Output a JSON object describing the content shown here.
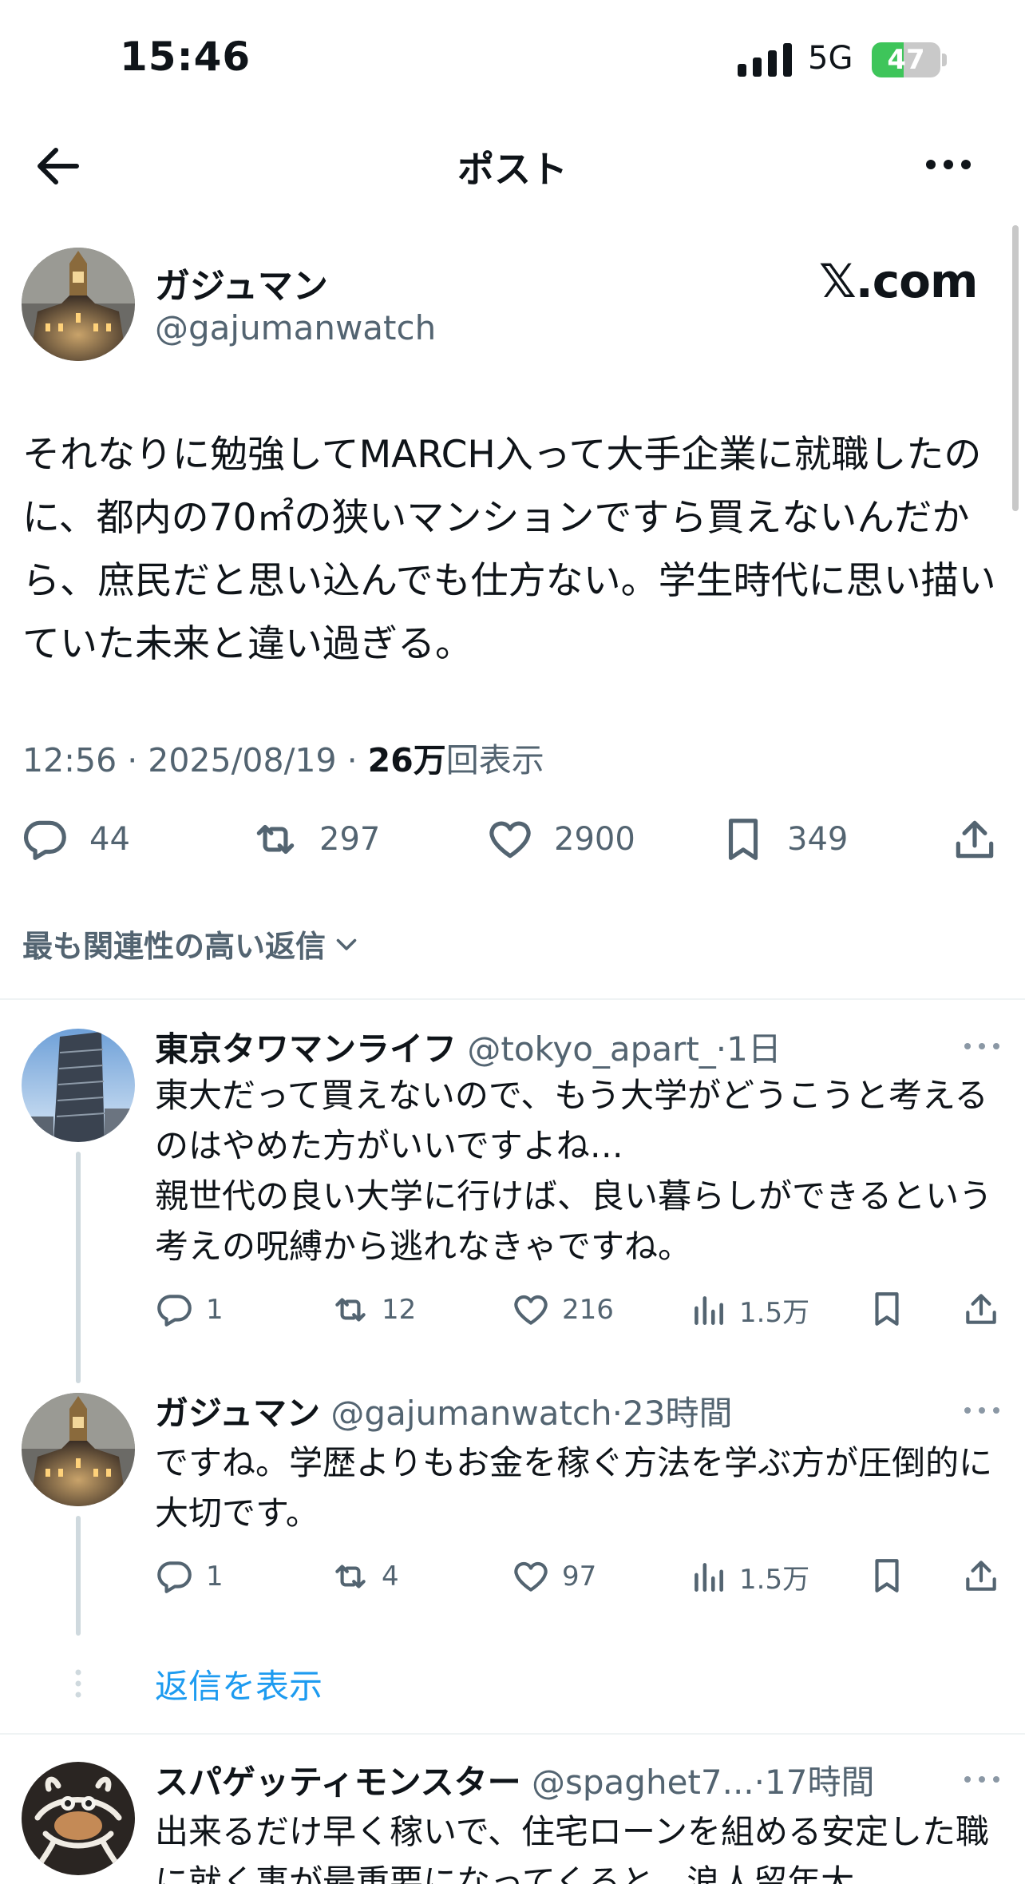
{
  "status_bar": {
    "time": "15:46",
    "network": "5G",
    "battery_percent": 47,
    "battery_label": "47"
  },
  "header": {
    "title": "ポスト",
    "back_icon": "arrow-left-icon",
    "more_icon": "ellipsis-icon"
  },
  "post": {
    "author_name": "ガジュマン",
    "author_handle": "@gajumanwatch",
    "watermark": "𝕏.com",
    "text": "それなりに勉強してMARCH入って大手企業に就職したのに、都内の70㎡の狭いマンションですら買えないんだから、庶民だと思い込んでも仕方ない。学生時代に思い描いていた未来と違い過ぎる。",
    "time": "12:56 · 2025/08/19 · ",
    "views_count": "26万",
    "views_label": "回表示",
    "replies": "44",
    "reposts": "297",
    "likes": "2900",
    "bookmarks": "349"
  },
  "sort": {
    "label": "最も関連性の高い返信"
  },
  "replies": [
    {
      "name": "東京タワマンライフ",
      "handle": "@tokyo_apart_",
      "time": "·1日",
      "text": "東大だって買えないので、もう大学がどうこうと考えるのはやめた方がいいですよね…\n親世代の良い大学に行けば、良い暮らしができるという考えの呪縛から逃れなきゃですね。",
      "replies": "1",
      "reposts": "12",
      "likes": "216",
      "views": "1.5万"
    },
    {
      "name": "ガジュマン",
      "handle": "@gajumanwatch",
      "time": "·23時間",
      "text": "ですね。学歴よりもお金を稼ぐ方法を学ぶ方が圧倒的に大切です。",
      "replies": "1",
      "reposts": "4",
      "likes": "97",
      "views": "1.5万"
    },
    {
      "name": "スパゲッティモンスター",
      "handle": "@spaghet7...",
      "time": "·17時間",
      "text": "出来るだけ早く稼いで、住宅ローンを組める安定した職に就く事が最重要になってくると、浪人留年大"
    }
  ],
  "show_replies": "返信を表示",
  "colors": {
    "text": "#0f1419",
    "secondary": "#536471",
    "link": "#1d9bf0",
    "battery": "#3ec55a"
  }
}
